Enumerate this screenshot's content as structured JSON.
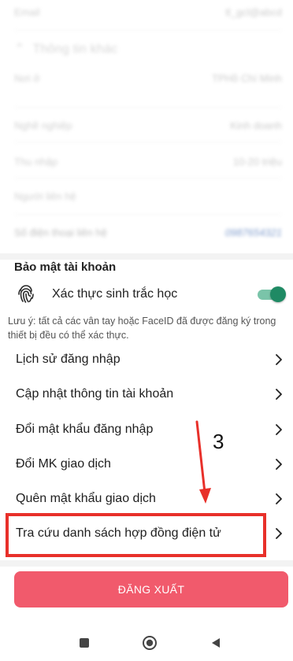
{
  "blurred": {
    "row1": {
      "label": "Email",
      "value": "tl_gcl@abcd"
    },
    "section_title": "Thông tin khác",
    "row2": {
      "label": "Nơi ở",
      "value": "TPHồ Chí Minh"
    },
    "row3": {
      "label": "Nghề nghiệp",
      "value": "Kinh doanh"
    },
    "row4": {
      "label": "Thu nhập",
      "value": "10-20 triệu"
    },
    "row5": {
      "label": "Người liên hệ",
      "value": ""
    },
    "row6": {
      "label": "Số điện thoại liên hệ",
      "value": "0987654321"
    }
  },
  "security": {
    "title": "Bảo mật tài khoản",
    "biometric_label": "Xác thực sinh trắc học",
    "biometric_enabled": true,
    "note": "Lưu ý: tất cả các vân tay hoặc FaceID đã được đăng ký trong thiết bị đều có thể xác thực."
  },
  "menu": [
    {
      "label": "Lịch sử đăng nhập"
    },
    {
      "label": "Cập nhật thông tin tài khoản"
    },
    {
      "label": "Đổi mật khẩu đăng nhập"
    },
    {
      "label": "Đổi MK giao dịch"
    },
    {
      "label": "Quên mật khẩu giao dịch"
    },
    {
      "label": "Tra cứu danh sách hợp đồng điện tử"
    }
  ],
  "logout_label": "ĐĂNG XUẤT",
  "annotation": {
    "step_number": "3",
    "color": "#e8302a"
  },
  "colors": {
    "toggle_on": "#1f8a64",
    "logout_button": "#f15a6c"
  }
}
